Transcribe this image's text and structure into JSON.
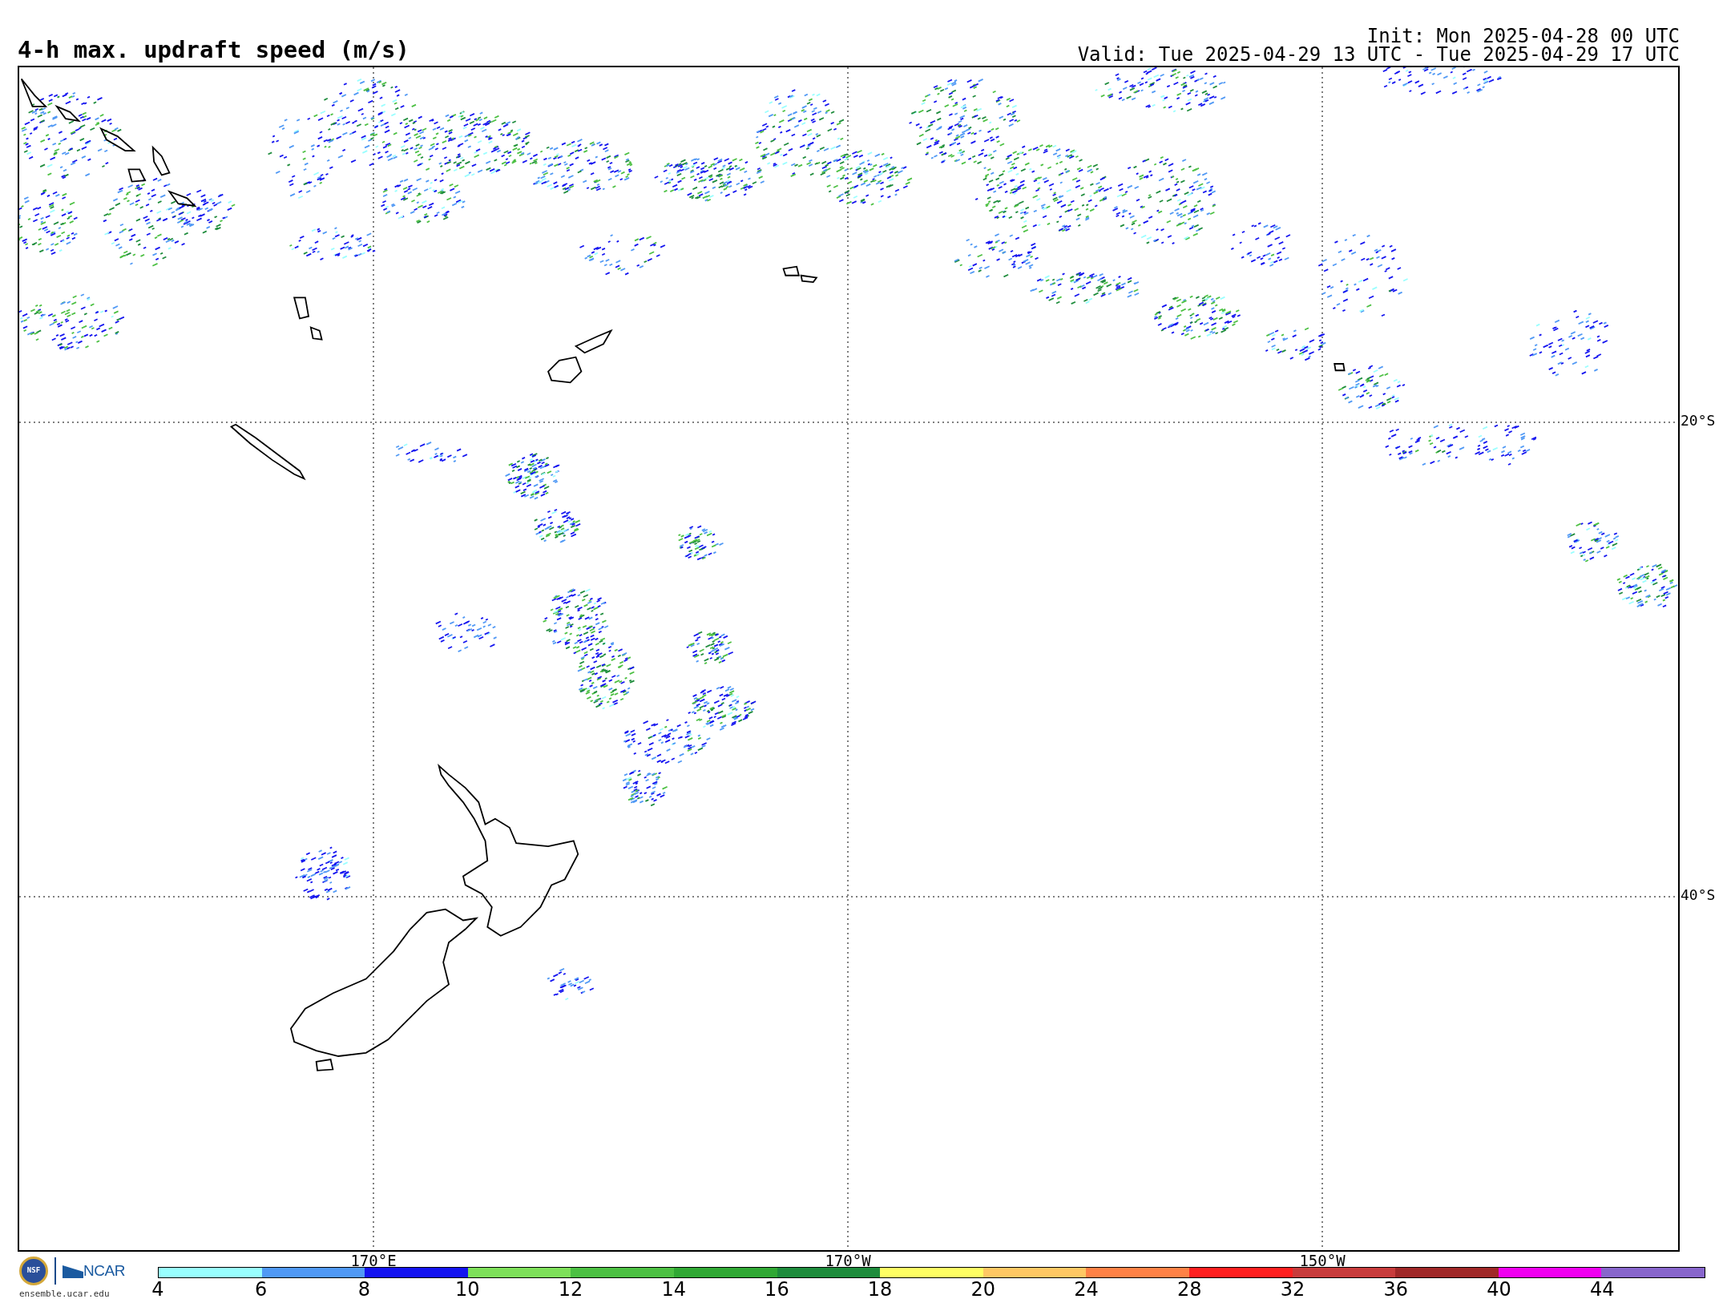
{
  "title": "4-h max. updraft speed (m/s)",
  "init": "Init: Mon 2025-04-28 00 UTC",
  "valid": "Valid: Tue 2025-04-29 13 UTC - Tue 2025-04-29 17 UTC",
  "map": {
    "lat_labels": [
      "20°S",
      "40°S"
    ],
    "lon_labels": [
      "170°E",
      "170°W",
      "150°W"
    ]
  },
  "logos": {
    "seal": "NSF",
    "org": "NCAR",
    "url": "ensemble.ucar.edu"
  },
  "colorbar": {
    "bins": [
      {
        "color": "#99ffff"
      },
      {
        "color": "#5099f5"
      },
      {
        "color": "#1414f0"
      },
      {
        "color": "#7ee05a"
      },
      {
        "color": "#4cc043"
      },
      {
        "color": "#30a834"
      },
      {
        "color": "#1e8c3c"
      },
      {
        "color": "#ffff64"
      },
      {
        "color": "#ffc864"
      },
      {
        "color": "#ff8246"
      },
      {
        "color": "#ff2020"
      },
      {
        "color": "#c83c3c"
      },
      {
        "color": "#a02828"
      },
      {
        "color": "#f000f0"
      },
      {
        "color": "#8866cc"
      }
    ],
    "ticks": [
      "4",
      "6",
      "8",
      "10",
      "12",
      "14",
      "16",
      "18",
      "20",
      "24",
      "28",
      "32",
      "36",
      "40",
      "44"
    ]
  }
}
